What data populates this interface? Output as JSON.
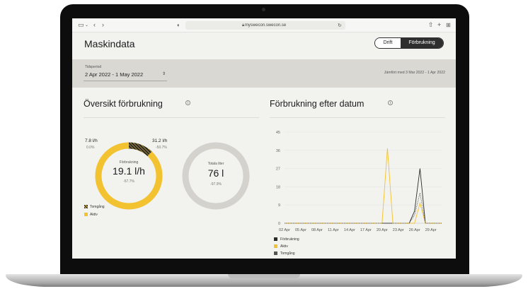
{
  "browser": {
    "url": "myswecon.swecon.se"
  },
  "page": {
    "title": "Maskindata",
    "toggle": {
      "drift": "Drift",
      "forbrukning": "Förbrukning",
      "active": "Förbrukning"
    }
  },
  "period": {
    "label": "Tidsperiod",
    "value": "2 Apr 2022 - 1 May 2022",
    "compare": "Jämfört med 3 Mar 2022 - 1 Apr 2022"
  },
  "overview": {
    "heading": "Översikt förbrukning",
    "idle": {
      "value": "7.8 l/h",
      "change": "0.0%"
    },
    "active": {
      "value": "31.2 l/h",
      "change": "-50.7%"
    },
    "donut1": {
      "label": "Förbrukning",
      "value": "19.1 l/h",
      "change": "-57.7%",
      "idle_fraction": 0.12
    },
    "donut2": {
      "label": "Totala liter",
      "value": "76 l",
      "change": "-97.9%"
    },
    "legend": [
      {
        "name": "Tomgång",
        "color": "#2a2a2a"
      },
      {
        "name": "Aktiv",
        "color": "#f2c230"
      }
    ]
  },
  "chart_section": {
    "heading": "Förbrukning efter datum"
  },
  "chart_data": {
    "type": "line",
    "categories": [
      "02 Apr",
      "03 Apr",
      "04 Apr",
      "05 Apr",
      "06 Apr",
      "07 Apr",
      "08 Apr",
      "09 Apr",
      "10 Apr",
      "11 Apr",
      "12 Apr",
      "13 Apr",
      "14 Apr",
      "15 Apr",
      "16 Apr",
      "17 Apr",
      "18 Apr",
      "19 Apr",
      "20 Apr",
      "21 Apr",
      "22 Apr",
      "23 Apr",
      "24 Apr",
      "25 Apr",
      "26 Apr",
      "27 Apr",
      "28 Apr",
      "29 Apr",
      "30 Apr",
      "01 May"
    ],
    "tick_labels": [
      "02 Apr",
      "05 Apr",
      "08 Apr",
      "11 Apr",
      "14 Apr",
      "17 Apr",
      "20 Apr",
      "23 Apr",
      "26 Apr",
      "29 Apr"
    ],
    "yticks": [
      0,
      9,
      18,
      27,
      36,
      45
    ],
    "ylim": [
      0,
      45
    ],
    "series": [
      {
        "name": "Förbrukning",
        "color": "#2b2b2b",
        "dash": false,
        "values": [
          0,
          0,
          0,
          0,
          0,
          0,
          0,
          0,
          0,
          0,
          0,
          0,
          0,
          0,
          0,
          0,
          0,
          0,
          0,
          0,
          0,
          0,
          0,
          0,
          6,
          27,
          0,
          0,
          0,
          0
        ]
      },
      {
        "name": "Aktiv",
        "color": "#f2c230",
        "dash": false,
        "values": [
          0,
          0,
          0,
          0,
          0,
          0,
          0,
          0,
          0,
          0,
          0,
          0,
          0,
          0,
          0,
          0,
          0,
          0,
          0,
          37,
          0,
          0,
          0,
          0,
          0,
          10,
          0,
          0,
          0,
          0
        ]
      },
      {
        "name": "Tomgång",
        "color": "#555555",
        "dash": true,
        "values": [
          0,
          0,
          0,
          0,
          0,
          0,
          0,
          0,
          0,
          0,
          0,
          0,
          0,
          0,
          0,
          0,
          0,
          0,
          0,
          0,
          0,
          0,
          0,
          0,
          4,
          15,
          0,
          0,
          0,
          0
        ]
      }
    ]
  }
}
